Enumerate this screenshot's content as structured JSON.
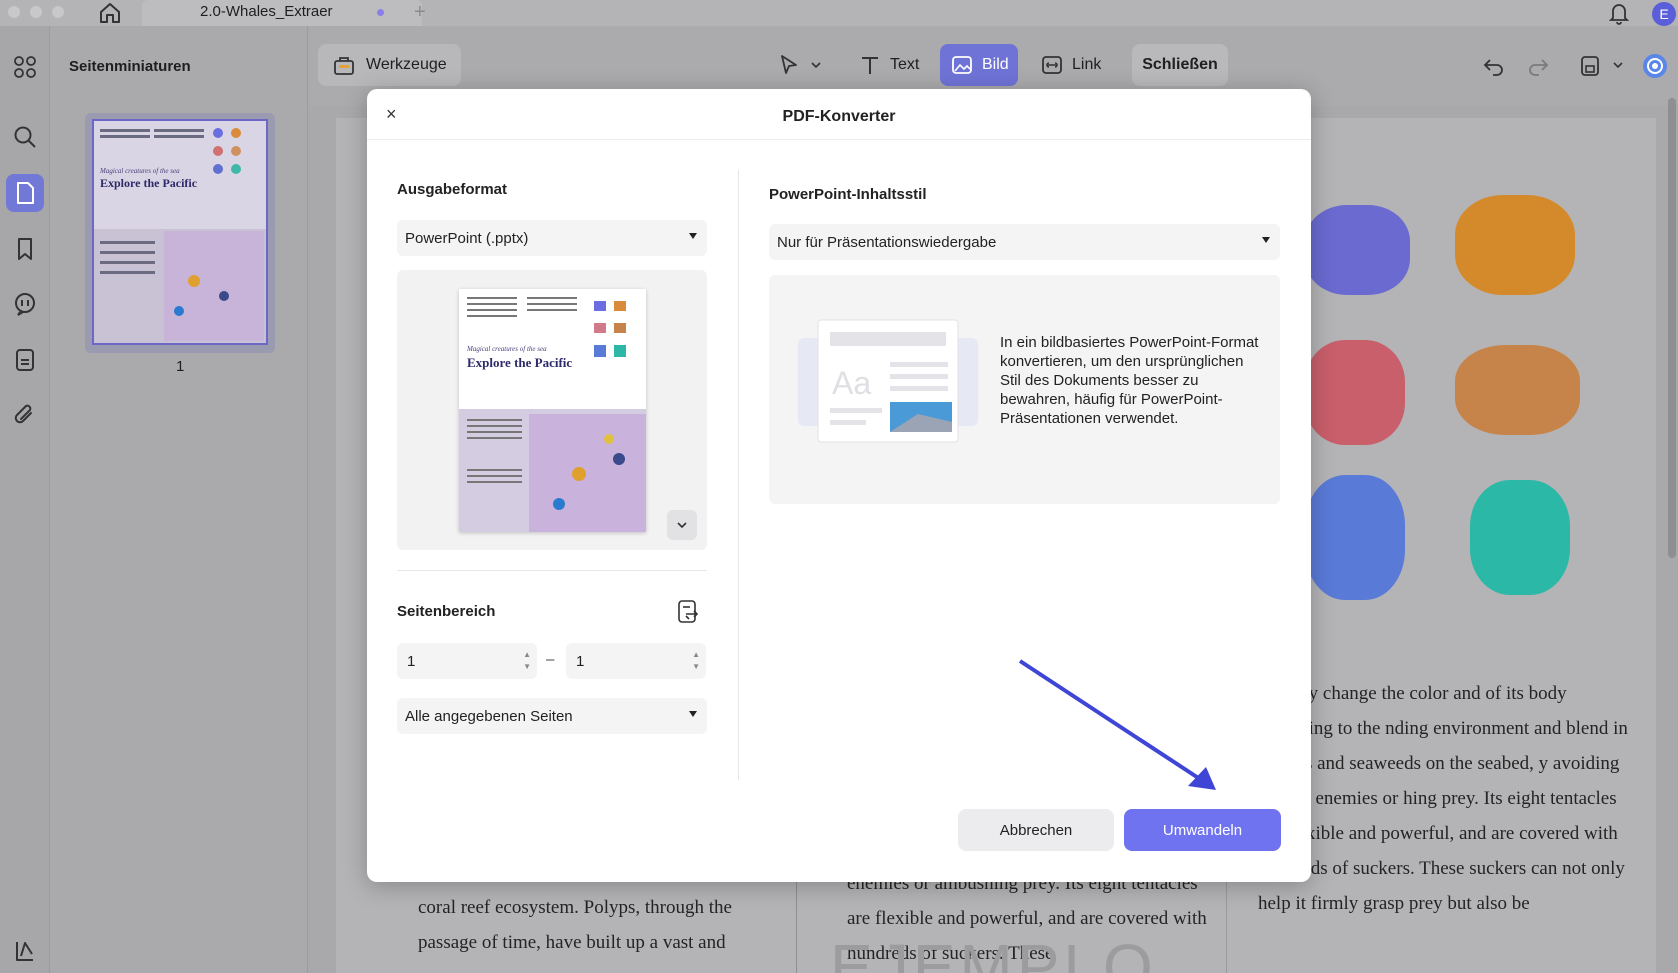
{
  "window": {
    "tab_title": "2.0-Whales_Extraer",
    "tab_plus": "+",
    "avatar_initial": "E"
  },
  "sidebar": {
    "title": "Seitenminiaturen",
    "page_number": "1",
    "items": [
      {
        "icon": "grid-icon"
      },
      {
        "icon": "search-icon"
      },
      {
        "icon": "pages-icon",
        "active": true
      },
      {
        "icon": "bookmark-icon"
      },
      {
        "icon": "comment-icon"
      },
      {
        "icon": "document-icon"
      },
      {
        "icon": "attachment-icon"
      },
      {
        "icon": "layers-icon"
      }
    ]
  },
  "toolbar": {
    "tools_label": "Werkzeuge",
    "text_label": "Text",
    "image_label": "Bild",
    "link_label": "Link",
    "close_label": "Schließen"
  },
  "document": {
    "right_text": "nstantly change the color and of its body according to the nding environment and blend in e rocks and seaweeds on the seabed, y avoiding natural enemies or hing prey. Its eight tentacles are flexible and powerful, and are covered with hundreds of suckers. These suckers can not only help it firmly grasp prey but also be",
    "left_text": "coral reef ecosystem. Polyps, through the passage of time, have built up a vast and",
    "mid_text": "enemies or ambushing prey. Its eight tentacles are flexible and powerful, and are covered with hundreds of suckers. These",
    "watermark": "EJEMPLO"
  },
  "dialog": {
    "title": "PDF-Konverter",
    "close_glyph": "×",
    "output_format_label": "Ausgabeformat",
    "output_format_value": "PowerPoint (.pptx)",
    "page_range_label": "Seitenbereich",
    "range_from": "1",
    "range_to": "1",
    "range_dash": "–",
    "pages_select_value": "Alle angegebenen Seiten",
    "style_label": "PowerPoint-Inhaltsstil",
    "style_value": "Nur für Präsentationswiedergabe",
    "style_description": "In ein bildbasiertes PowerPoint-Format konvertieren, um den ursprünglichen Stil des Dokuments besser zu bewahren, häufig für PowerPoint-Präsentationen verwendet.",
    "cancel_label": "Abbrechen",
    "convert_label": "Umwandeln"
  },
  "preview": {
    "subtitle": "Magical creatures of the sea",
    "title": "Explore the Pacific"
  },
  "colors": {
    "accent": "#6f73f0",
    "active_tool": "#6f73d6",
    "arrow": "#3f45d4"
  }
}
